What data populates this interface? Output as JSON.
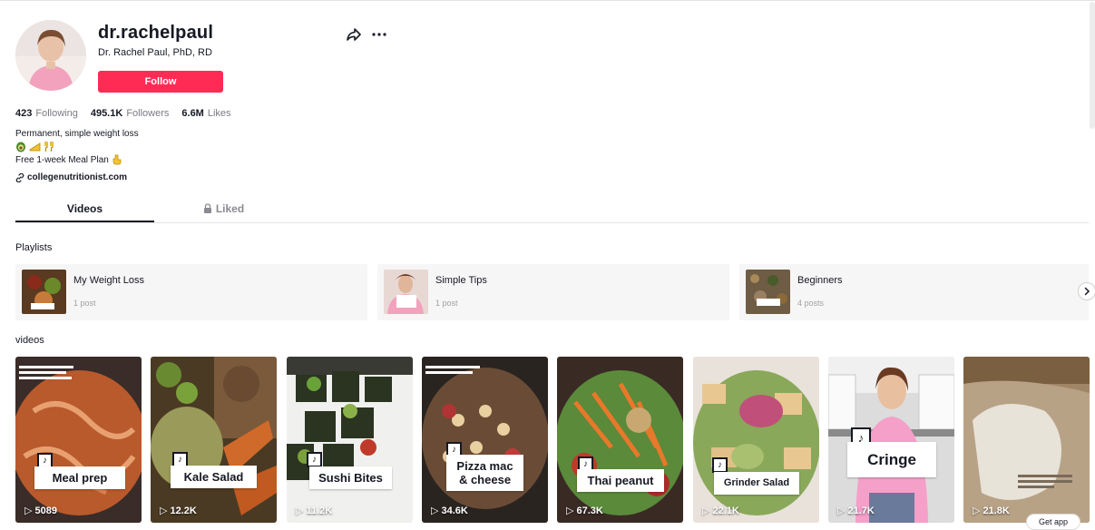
{
  "profile": {
    "username": "dr.rachelpaul",
    "display_name": "Dr. Rachel Paul, PhD, RD",
    "follow_label": "Follow",
    "stats": [
      {
        "value": "423",
        "label": "Following"
      },
      {
        "value": "495.1K",
        "label": "Followers"
      },
      {
        "value": "6.6M",
        "label": "Likes"
      }
    ],
    "bio_line1": "Permanent, simple weight loss",
    "bio_line2": "Free 1-week Meal Plan",
    "link": "collegenutritionist.com"
  },
  "tabs": [
    {
      "label": "Videos",
      "active": true
    },
    {
      "label": "Liked",
      "locked": true
    }
  ],
  "playlists": {
    "title": "Playlists",
    "items": [
      {
        "name": "My Weight Loss",
        "count": "1 post",
        "color": "#6e4b2a"
      },
      {
        "name": "Simple Tips",
        "count": "1 post",
        "color": "#e4a3c0"
      },
      {
        "name": "Beginners",
        "count": "4 posts",
        "color": "#7a6a52"
      }
    ]
  },
  "videos": {
    "title": "videos",
    "items": [
      {
        "label": "Meal prep",
        "views": "5089",
        "bg": "#b55a2c"
      },
      {
        "label": "Kale Salad",
        "views": "12.2K",
        "bg": "#5a4a2a"
      },
      {
        "label": "Sushi Bites",
        "views": "11.2K",
        "bg": "#2d3a24"
      },
      {
        "label": "Pizza mac & cheese",
        "views": "34.6K",
        "bg": "#6a4c3a"
      },
      {
        "label": "Thai peanut",
        "views": "67.3K",
        "bg": "#b84a2a"
      },
      {
        "label": "Grinder Salad",
        "views": "22.1K",
        "bg": "#b07a62"
      },
      {
        "label": "Cringe",
        "views": "21.7K",
        "bg": "#d8d8d8"
      },
      {
        "label": "",
        "views": "21.8K",
        "bg": "#b8a286"
      }
    ]
  },
  "get_app": "Get app",
  "colors": {
    "accent": "#fe2c55",
    "text": "#161823",
    "muted": "#7a7b81"
  }
}
